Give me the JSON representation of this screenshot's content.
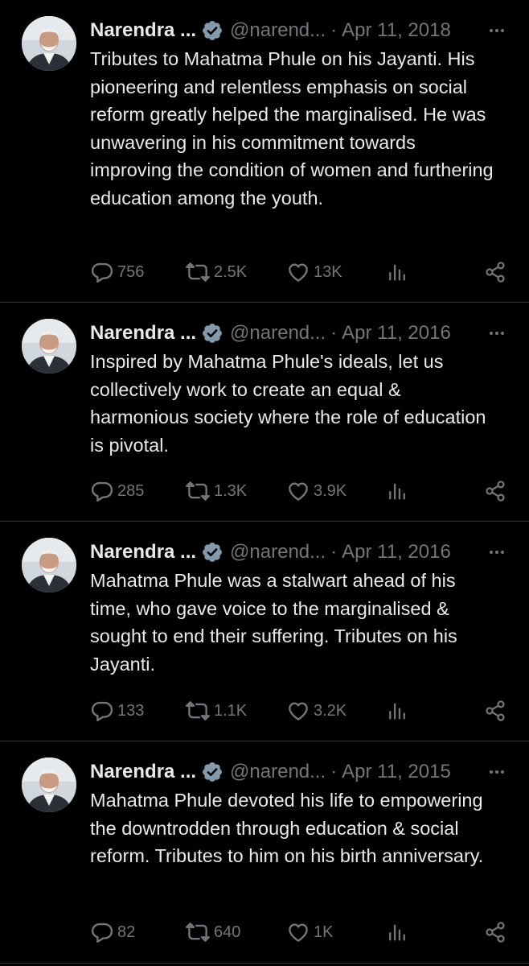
{
  "theme": {
    "background": "#000000",
    "text": "#e7e9ea",
    "muted": "#71767b",
    "verified_badge": "#829aab"
  },
  "tweets": [
    {
      "name": "Narendra ...",
      "handle": "@narend...",
      "separator": "·",
      "date": "Apr 11, 2018",
      "text": "Tributes to Mahatma Phule on his Jayanti. His pioneering and relentless emphasis on social reform greatly helped the marginalised. He was unwavering in his commitment towards improving the condition of women and furthering education among the youth.",
      "replies": "756",
      "retweets": "2.5K",
      "likes": "13K",
      "icons": [
        "avatar",
        "verified-badge-icon",
        "more-icon",
        "reply-icon",
        "retweet-icon",
        "like-icon",
        "views-icon",
        "share-icon"
      ]
    },
    {
      "name": "Narendra ...",
      "handle": "@narend...",
      "separator": "·",
      "date": "Apr 11, 2016",
      "text": "Inspired by Mahatma Phule's ideals, let us collectively work to create an equal & harmonious society where the role of education is pivotal.",
      "replies": "285",
      "retweets": "1.3K",
      "likes": "3.9K",
      "icons": [
        "avatar",
        "verified-badge-icon",
        "more-icon",
        "reply-icon",
        "retweet-icon",
        "like-icon",
        "views-icon",
        "share-icon"
      ]
    },
    {
      "name": "Narendra ...",
      "handle": "@narend...",
      "separator": "·",
      "date": "Apr 11, 2016",
      "text": "Mahatma Phule was a stalwart ahead of his time, who gave voice to the marginalised & sought to end their suffering. Tributes on his Jayanti.",
      "replies": "133",
      "retweets": "1.1K",
      "likes": "3.2K",
      "icons": [
        "avatar",
        "verified-badge-icon",
        "more-icon",
        "reply-icon",
        "retweet-icon",
        "like-icon",
        "views-icon",
        "share-icon"
      ]
    },
    {
      "name": "Narendra ...",
      "handle": "@narend...",
      "separator": "·",
      "date": "Apr 11, 2015",
      "text": "Mahatma Phule devoted his life to empowering the downtrodden through education & social reform. Tributes to him on his birth anniversary.",
      "replies": "82",
      "retweets": "640",
      "likes": "1K",
      "icons": [
        "avatar",
        "verified-badge-icon",
        "more-icon",
        "reply-icon",
        "retweet-icon",
        "like-icon",
        "views-icon",
        "share-icon"
      ]
    }
  ]
}
